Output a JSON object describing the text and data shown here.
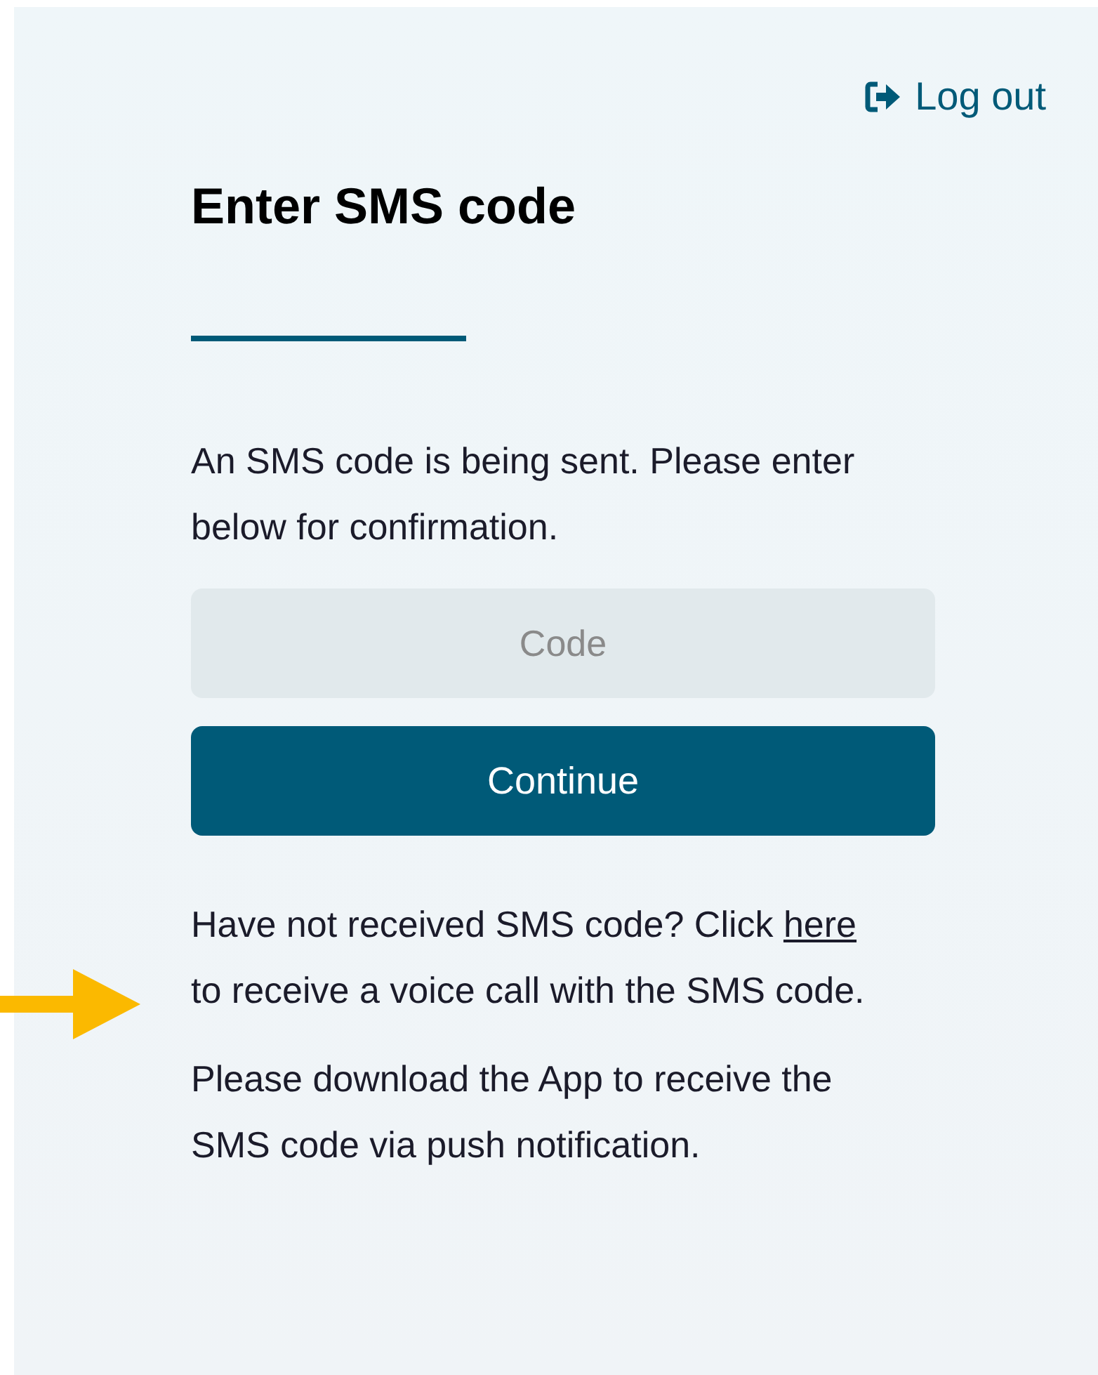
{
  "header": {
    "logout_label": "Log out"
  },
  "title": "Enter SMS code",
  "intro": "An SMS code is being sent. Please enter below for confirmation.",
  "code_field": {
    "placeholder": "Code"
  },
  "continue_button": "Continue",
  "voice_call_note": {
    "before": "Have not received SMS code? Click",
    "link": "here",
    "after": "to receive a voice call with the SMS code."
  },
  "app_note": "Please download the App to receive the SMS code via push notification."
}
